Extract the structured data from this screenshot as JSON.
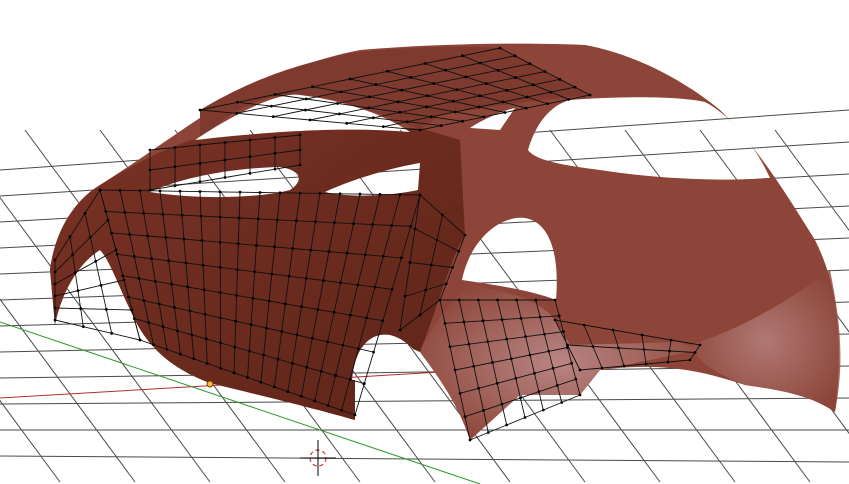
{
  "viewport": {
    "mode": "3d-viewport",
    "object": "car-body-mesh",
    "colors": {
      "background": "#ffffff",
      "grid": "#4a4a4a",
      "x_axis": "#b03030",
      "y_axis": "#2e9a2e",
      "body": "#8c4538",
      "body_dark": "#6e2a20",
      "body_light": "#a86a66",
      "wire": "#111111"
    }
  }
}
